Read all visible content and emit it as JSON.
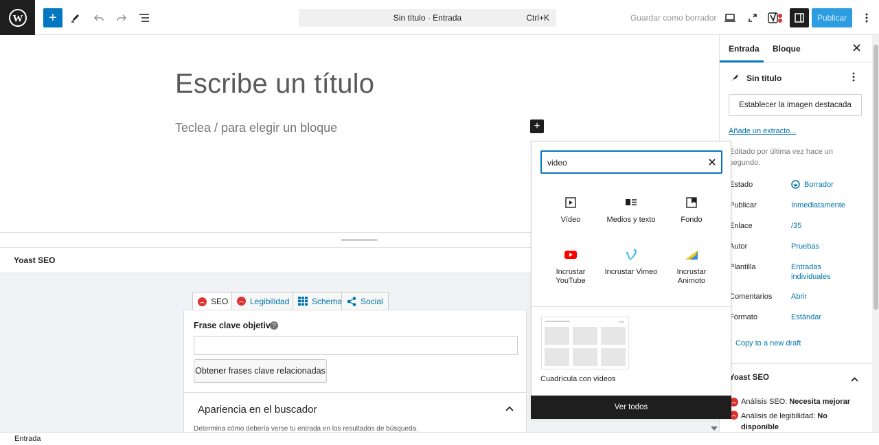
{
  "topbar": {
    "command_title": "Sin título · Entrada",
    "command_shortcut": "Ctrl+K",
    "save_draft": "Guardar como borrador",
    "publish": "Publicar"
  },
  "editor": {
    "title_placeholder": "Escribe un título",
    "block_placeholder": "Teclea / para elegir un bloque"
  },
  "yoast": {
    "header": "Yoast SEO",
    "tabs": [
      {
        "label": "SEO"
      },
      {
        "label": "Legibilidad"
      },
      {
        "label": "Schema"
      },
      {
        "label": "Social"
      }
    ],
    "focus_keyphrase_label": "Frase clave objetivo",
    "related_button": "Obtener frases clave relacionadas",
    "appearance_title": "Apariencia en el buscador",
    "appearance_desc": "Determina cómo debería verse tu entrada en los resultados de búsqueda."
  },
  "inserter": {
    "search_value": "video",
    "blocks": [
      {
        "label": "Vídeo"
      },
      {
        "label": "Medios y texto"
      },
      {
        "label": "Fondo"
      },
      {
        "label": "Incrustar YouTube"
      },
      {
        "label": "Incrustar Vimeo"
      },
      {
        "label": "Incrustar Animoto"
      }
    ],
    "pattern_label": "Cuadrícula con vídeos",
    "see_all": "Ver todos"
  },
  "sidebar": {
    "tabs": [
      "Entrada",
      "Bloque"
    ],
    "post_title": "Sin título",
    "featured_image_button": "Establecer la imagen destacada",
    "excerpt_link": "Añade un extracto...",
    "last_edited": "Editado por última vez hace un segundo.",
    "rows": [
      {
        "label": "Estado",
        "value": "Borrador"
      },
      {
        "label": "Publicar",
        "value": "Inmediatamente"
      },
      {
        "label": "Enlace",
        "value": "/35"
      },
      {
        "label": "Autor",
        "value": "Pruebas"
      },
      {
        "label": "Plantilla",
        "value": "Entradas individuales"
      },
      {
        "label": "Comentarios",
        "value": "Abrir"
      },
      {
        "label": "Formato",
        "value": "Estándar"
      }
    ],
    "copy_draft": "Copy to a new draft",
    "yoast_title": "Yoast SEO",
    "seo_analysis_prefix": "Análisis SEO: ",
    "seo_analysis_value": "Necesita mejorar",
    "read_analysis_prefix": "Análisis de legibilidad: ",
    "read_analysis_value": "No disponible"
  },
  "statusbar": {
    "label": "Entrada"
  },
  "colors": {
    "accent": "#0077c0",
    "error": "#dc3232",
    "vimeo": "#1ab7ea",
    "youtube": "#ff0000"
  }
}
